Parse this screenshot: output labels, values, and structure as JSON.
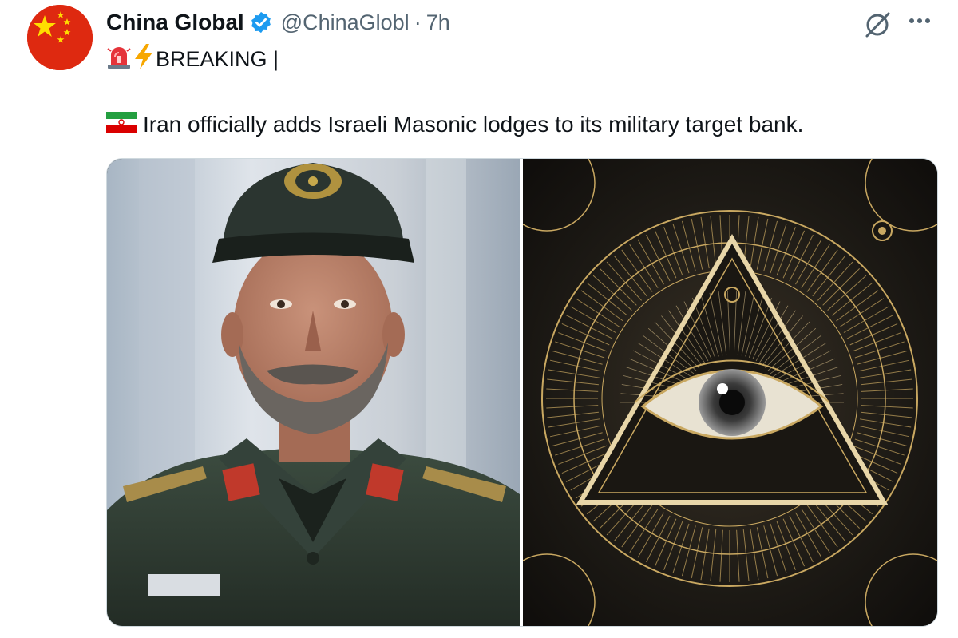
{
  "tweet": {
    "author_name": "China Global",
    "handle": "@ChinaGlobl",
    "separator": "·",
    "time": "7h",
    "line1_text": "BREAKING |",
    "line2_text": "Iran officially adds Israeli Masonic lodges to its military target bank."
  },
  "icons": {
    "avatar": "china-flag",
    "verified": "verified-badge",
    "grok": "grok-icon",
    "more": "more-icon",
    "siren": "police-siren-emoji",
    "bolt": "lightning-emoji",
    "flag": "iran-flag-emoji"
  },
  "media": {
    "left": "commander-photo",
    "right": "eye-of-providence-artwork"
  },
  "colors": {
    "verified": "#1d9bf0",
    "secondary_text": "#536471",
    "china_red": "#de2910",
    "gold": "#c9a861"
  }
}
